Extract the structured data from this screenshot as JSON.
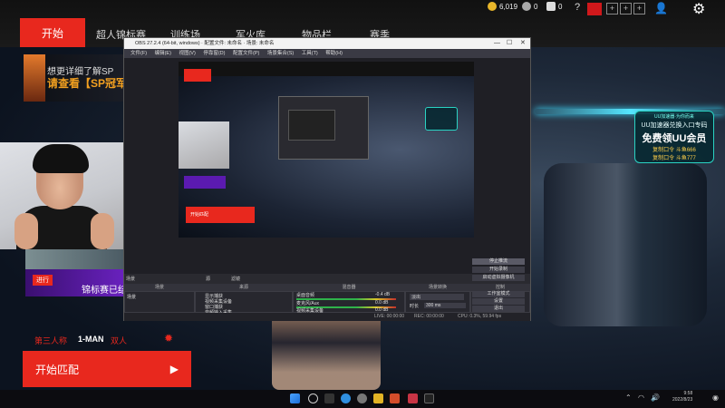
{
  "nav": {
    "start_label": "开始",
    "items": [
      "超人锦标赛",
      "训练场",
      "军火库",
      "物品栏",
      "赛季"
    ]
  },
  "currency": {
    "gold": "6,019",
    "silver": "0",
    "bonds": "0",
    "help": "?"
  },
  "banner": {
    "line1": "想更详细了解SP",
    "line2": "请查看【SP冠军"
  },
  "promo": {
    "tag": "进行",
    "text": "锦标赛已结"
  },
  "modes": {
    "third_person": "第三人称",
    "one_man": "1-MAN",
    "duo": "双人"
  },
  "start_match": {
    "label": "开始匹配",
    "arrow": "▶"
  },
  "uu": {
    "top": "UU加速器·为你而来",
    "line1": "UU加速器兑换入口专码",
    "line2": "免费领UU会员",
    "line3": "复制口令 斗鱼666",
    "line4": "复制口令 斗鱼777"
  },
  "obs": {
    "title": "OBS 27.2.4 (64-bit, windows) · 配置文件: 未命名 · 场景: 未命名",
    "menu": [
      "文件(F)",
      "编辑(E)",
      "视图(V)",
      "停靠窗(D)",
      "配置文件(P)",
      "场景集合(S)",
      "工具(T)",
      "帮助(H)"
    ],
    "preview_start": "开始匹配",
    "scene_bar": {
      "label": "场景",
      "extra1": "源",
      "extra2": "滤镜"
    },
    "docks": {
      "scenes": "场景",
      "sources": "来源",
      "mixer": "混音器",
      "transitions": "场景转换",
      "controls": "控制"
    },
    "scene_item": "场景",
    "sources": [
      "显示捕获",
      "视频采集设备",
      "窗口捕获",
      "音频输入采集"
    ],
    "mixer": [
      {
        "name": "桌面音频",
        "db": "-0.4 dB"
      },
      {
        "name": "麦克风/Aux",
        "db": "0.0 dB"
      },
      {
        "name": "视频采集设备",
        "db": "0.0 dB"
      }
    ],
    "transition": {
      "type": "淡出",
      "duration_label": "时长",
      "duration": "300 ms"
    },
    "controls": [
      "停止推流",
      "开始录制",
      "启动虚拟摄像机",
      "工作室模式",
      "设置",
      "退出"
    ],
    "status": {
      "live": "LIVE: 00:00:00",
      "rec": "REC: 00:00:00",
      "cpu": "CPU: 0.3%, 59.94 fps"
    }
  },
  "taskbar": {
    "time": "9:58",
    "date": "2022/8/23"
  }
}
